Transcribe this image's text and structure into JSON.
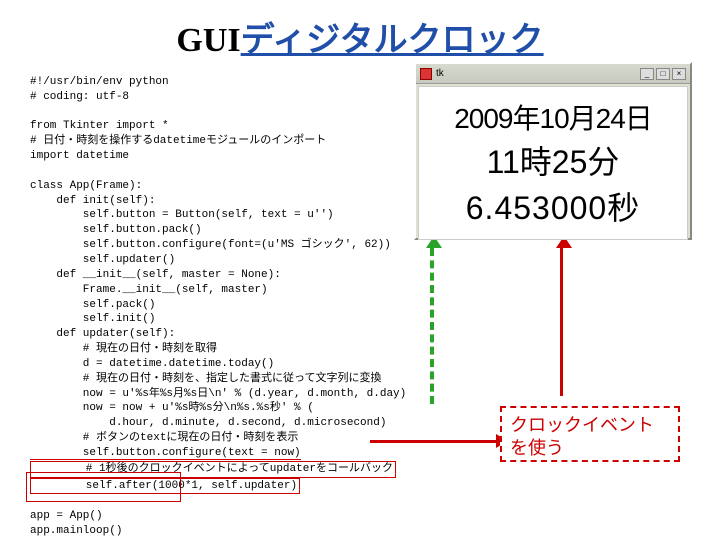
{
  "title": {
    "prefix": "GUI",
    "jp": "ディジタルクロック"
  },
  "code": {
    "l01": "#!/usr/bin/env python",
    "l02": "# coding: utf-8",
    "l03": "",
    "l04": "from Tkinter import *",
    "l05": "# 日付・時刻を操作するdatetimeモジュールのインポート",
    "l06": "import datetime",
    "l07": "",
    "l08": "class App(Frame):",
    "l09": "    def init(self):",
    "l10": "        self.button = Button(self, text = u'')",
    "l11": "        self.button.pack()",
    "l12": "        self.button.configure(font=(u'MS ゴシック', 62))",
    "l13": "        self.updater()",
    "l14": "    def __init__(self, master = None):",
    "l15": "        Frame.__init__(self, master)",
    "l16": "        self.pack()",
    "l17": "        self.init()",
    "l18": "    def updater(self):",
    "l19": "        # 現在の日付・時刻を取得",
    "l20": "        d = datetime.datetime.today()",
    "l21": "        # 現在の日付・時刻を、指定した書式に従って文字列に変換",
    "l22": "        now = u'%s年%s月%s日\\n' % (d.year, d.month, d.day)",
    "l23": "        now = now + u'%s時%s分\\n%s.%s秒' % (",
    "l24": "            d.hour, d.minute, d.second, d.microsecond)",
    "l25": "        # ボタンのtextに現在の日付・時刻を表示",
    "l26": "        self.button.configure(text = now)",
    "l27a": "        # 1秒後のクロックイベントによってupdaterをコールバック",
    "l27b": "        self.after(1000*1, self.updater)",
    "l28": "",
    "l29": "app = App()",
    "l30": "app.mainloop()"
  },
  "window": {
    "title": "tk",
    "line1": "2009年10月24日",
    "line2": "11時25分",
    "line3": "6.453000秒"
  },
  "callout": {
    "line1": "クロックイベント",
    "line2": "を使う"
  }
}
